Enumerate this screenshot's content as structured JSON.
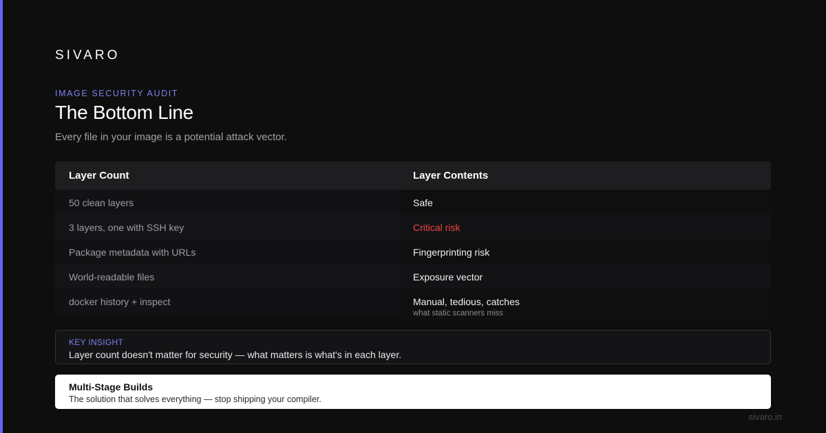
{
  "brand": "SIVARO",
  "eyebrow": "IMAGE SECURITY AUDIT",
  "title": "The Bottom Line",
  "subtitle": "Every file in your image is a potential attack vector.",
  "table": {
    "headers": [
      "Layer Count",
      "Layer Contents"
    ],
    "rows": [
      {
        "left": "50 clean layers",
        "right": "Safe"
      },
      {
        "left": "3 layers, one with SSH key",
        "right": "Critical risk"
      },
      {
        "left": "Package metadata with URLs",
        "right": "Fingerprinting risk"
      },
      {
        "left": "World-readable files",
        "right": "Exposure vector"
      },
      {
        "left": "docker history + inspect",
        "right": "Manual, tedious, catches",
        "note": "what static scanners miss"
      }
    ]
  },
  "insight": {
    "label": "KEY INSIGHT",
    "text": "Layer count doesn't matter for security — what matters is what's in each layer."
  },
  "solution": {
    "title": "Multi-Stage Builds",
    "text": "The solution that solves everything — stop shipping your compiler."
  },
  "footer": "sivaro.in",
  "colors": {
    "accent": "#6366f1",
    "critical": "#ef4444",
    "background": "#0e0e0f"
  }
}
